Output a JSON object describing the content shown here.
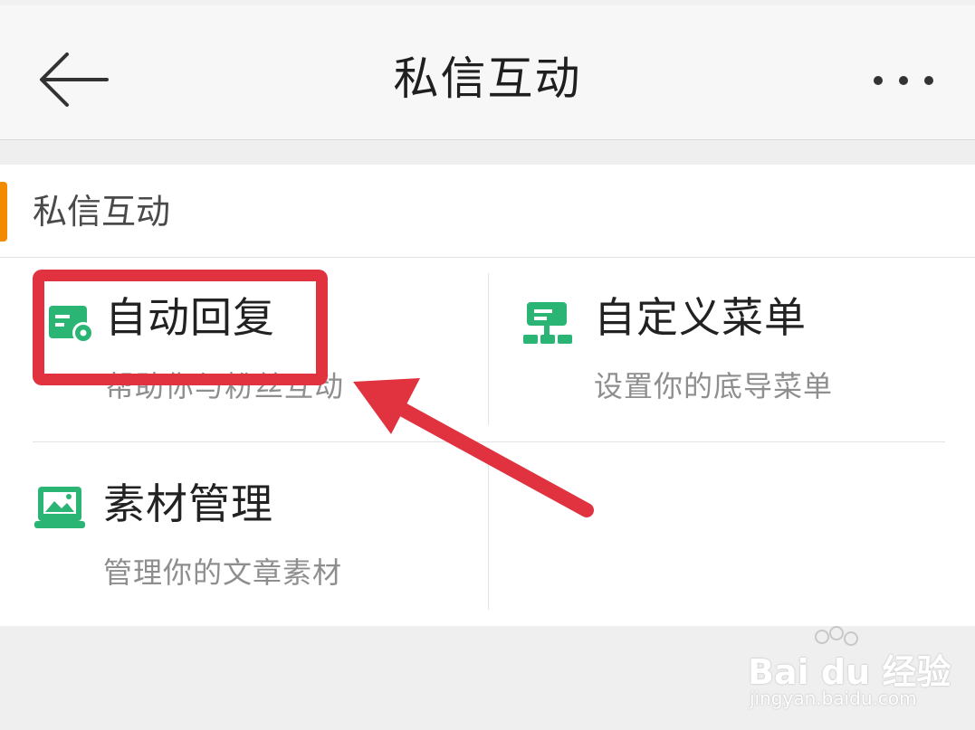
{
  "header": {
    "title": "私信互动",
    "back_icon": "arrow-left-icon",
    "more_icon": "more-dots-icon"
  },
  "section": {
    "title": "私信互动",
    "accent_color": "#f38b00"
  },
  "items": [
    {
      "title": "自动回复",
      "desc": "帮助你与粉丝互动",
      "icon": "auto-reply-icon"
    },
    {
      "title": "自定义菜单",
      "desc": "设置你的底导菜单",
      "icon": "custom-menu-icon"
    },
    {
      "title": "素材管理",
      "desc": "管理你的文章素材",
      "icon": "material-icon"
    }
  ],
  "colors": {
    "icon_green": "#2bb574",
    "annotation_red": "#e0323f"
  },
  "watermark": {
    "brand": "Bai du 经验",
    "url": "jingyan.baidu.com"
  }
}
